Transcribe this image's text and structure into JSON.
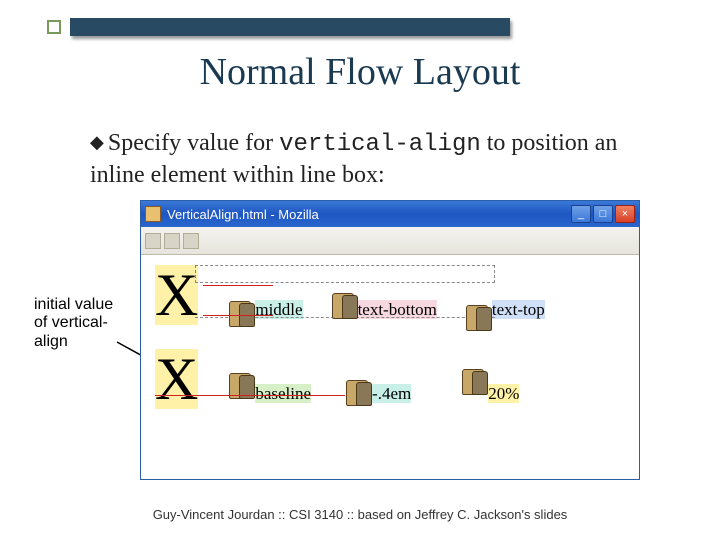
{
  "decoration": {
    "accent_color": "#294a63",
    "square_border": "#7a9a5c"
  },
  "title": "Normal Flow Layout",
  "bullet": {
    "pre": "Specify value for ",
    "code": "vertical-align",
    "post": " to position an inline element within line box:"
  },
  "sidenote": "initial value of vertical-align",
  "window": {
    "title": "VerticalAlign.html - Mozilla",
    "buttons": {
      "min": "_",
      "max": "□",
      "close": "×"
    }
  },
  "examples": {
    "row1": {
      "bigX": "X",
      "items": [
        {
          "label": "middle",
          "hl": "hl-cyan"
        },
        {
          "label": "text-bottom",
          "hl": "hl-pink"
        },
        {
          "label": "text-top",
          "hl": "hl-blue"
        }
      ]
    },
    "row2": {
      "bigX": "X",
      "items": [
        {
          "label": "baseline",
          "hl": "hl-green"
        },
        {
          "label": "-.4em",
          "hl": "hl-cyan"
        },
        {
          "label": "20%",
          "hl": "hl-yellow"
        }
      ]
    }
  },
  "footer": "Guy-Vincent Jourdan :: CSI 3140 :: based on Jeffrey C. Jackson's slides"
}
